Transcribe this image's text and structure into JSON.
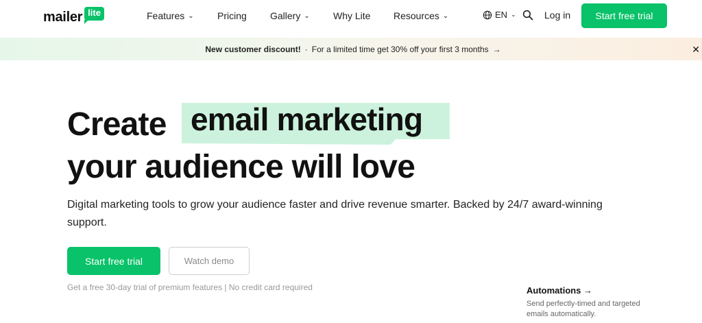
{
  "header": {
    "logo": {
      "text": "mailer",
      "badge": "lite"
    },
    "nav": [
      {
        "label": "Features",
        "has_dropdown": true
      },
      {
        "label": "Pricing",
        "has_dropdown": false
      },
      {
        "label": "Gallery",
        "has_dropdown": true
      },
      {
        "label": "Why Lite",
        "has_dropdown": false
      },
      {
        "label": "Resources",
        "has_dropdown": true
      }
    ],
    "language": "EN",
    "login_label": "Log in",
    "cta_label": "Start free trial"
  },
  "banner": {
    "strong": "New customer discount!",
    "separator": "·",
    "text": "For a limited time get 30% off your first 3 months",
    "arrow": "→",
    "close": "✕"
  },
  "hero": {
    "title_word": "Create",
    "title_highlight": "email marketing",
    "title_line2": "your audience will love",
    "subtitle": "Digital marketing tools to grow your audience faster and drive revenue smarter. Backed by 24/7 award-winning support.",
    "primary_cta": "Start free trial",
    "secondary_cta": "Watch demo",
    "trial_note": "Get a free 30-day trial of premium features | No credit card required"
  },
  "feature_card": {
    "title": "Automations →",
    "description": "Send perfectly-timed and targeted emails automatically."
  },
  "colors": {
    "brand_green": "#09c269",
    "highlight_green": "#ccf2dd"
  },
  "icons": {
    "language": "globe-icon",
    "search": "search-icon",
    "dropdown": "chevron-down-icon",
    "close": "close-icon"
  }
}
